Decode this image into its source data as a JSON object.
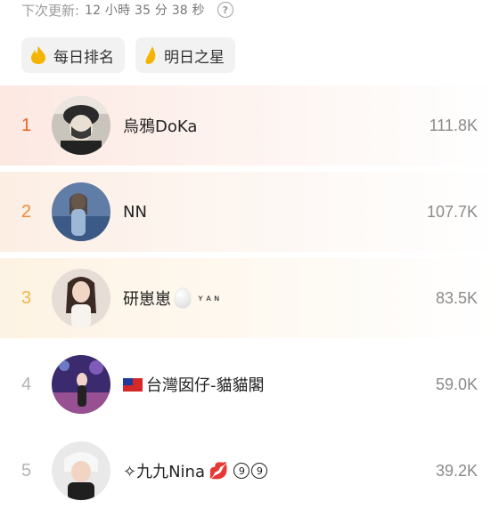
{
  "header": {
    "next_update_label": "下次更新:",
    "next_update_value": "12 小時 35 分 38 秒",
    "help_icon": "question-circle-icon"
  },
  "tabs": [
    {
      "label": "每日排名",
      "icon": "flame-icon"
    },
    {
      "label": "明日之星",
      "icon": "flame-icon"
    }
  ],
  "ranking": [
    {
      "rank": "1",
      "name": "烏鴉DoKa",
      "score": "111.8K",
      "rank_color": "#e8641e"
    },
    {
      "rank": "2",
      "name": "NN",
      "score": "107.7K",
      "rank_color": "#ef8a3a"
    },
    {
      "rank": "3",
      "name": "研崽崽",
      "suffix": "ʏᴀɴ",
      "score": "83.5K",
      "rank_color": "#f3b545"
    },
    {
      "rank": "4",
      "name": "台灣囡仔-貓貓閣",
      "score": "59.0K",
      "rank_color": "#b3b3b3"
    },
    {
      "rank": "5",
      "name": "✧九九Nina",
      "suffix_nine": "9",
      "score": "39.2K",
      "rank_color": "#b3b3b3"
    }
  ]
}
